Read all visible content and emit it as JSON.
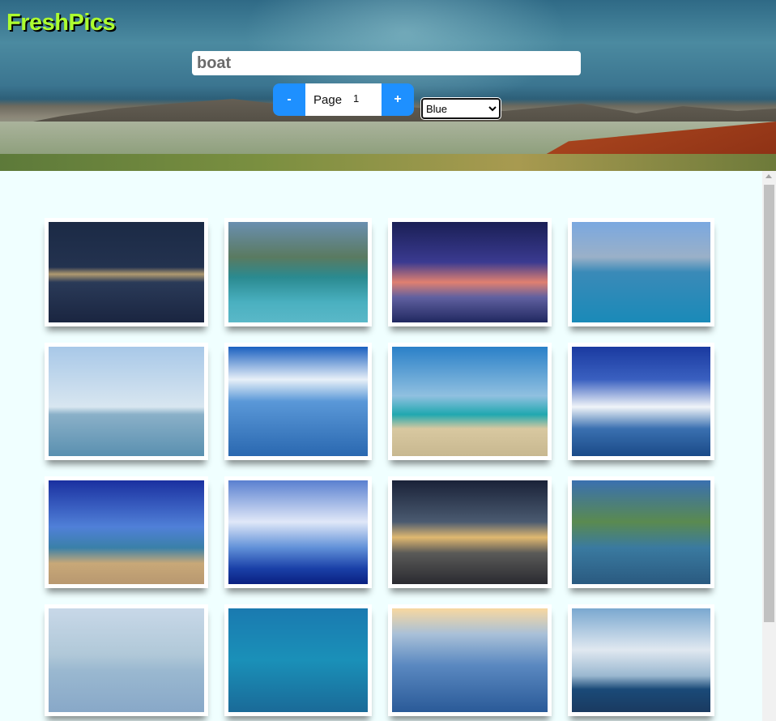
{
  "header": {
    "logo": "FreshPics",
    "search_value": "boat",
    "pager": {
      "minus_label": "-",
      "page_label": "Page",
      "page_number": "1",
      "plus_label": "+"
    },
    "color_filter": {
      "selected": "Blue"
    }
  },
  "gallery": {
    "photo_count": 16,
    "accent_colors": [
      "#1e90ff",
      "#adff2f"
    ]
  }
}
